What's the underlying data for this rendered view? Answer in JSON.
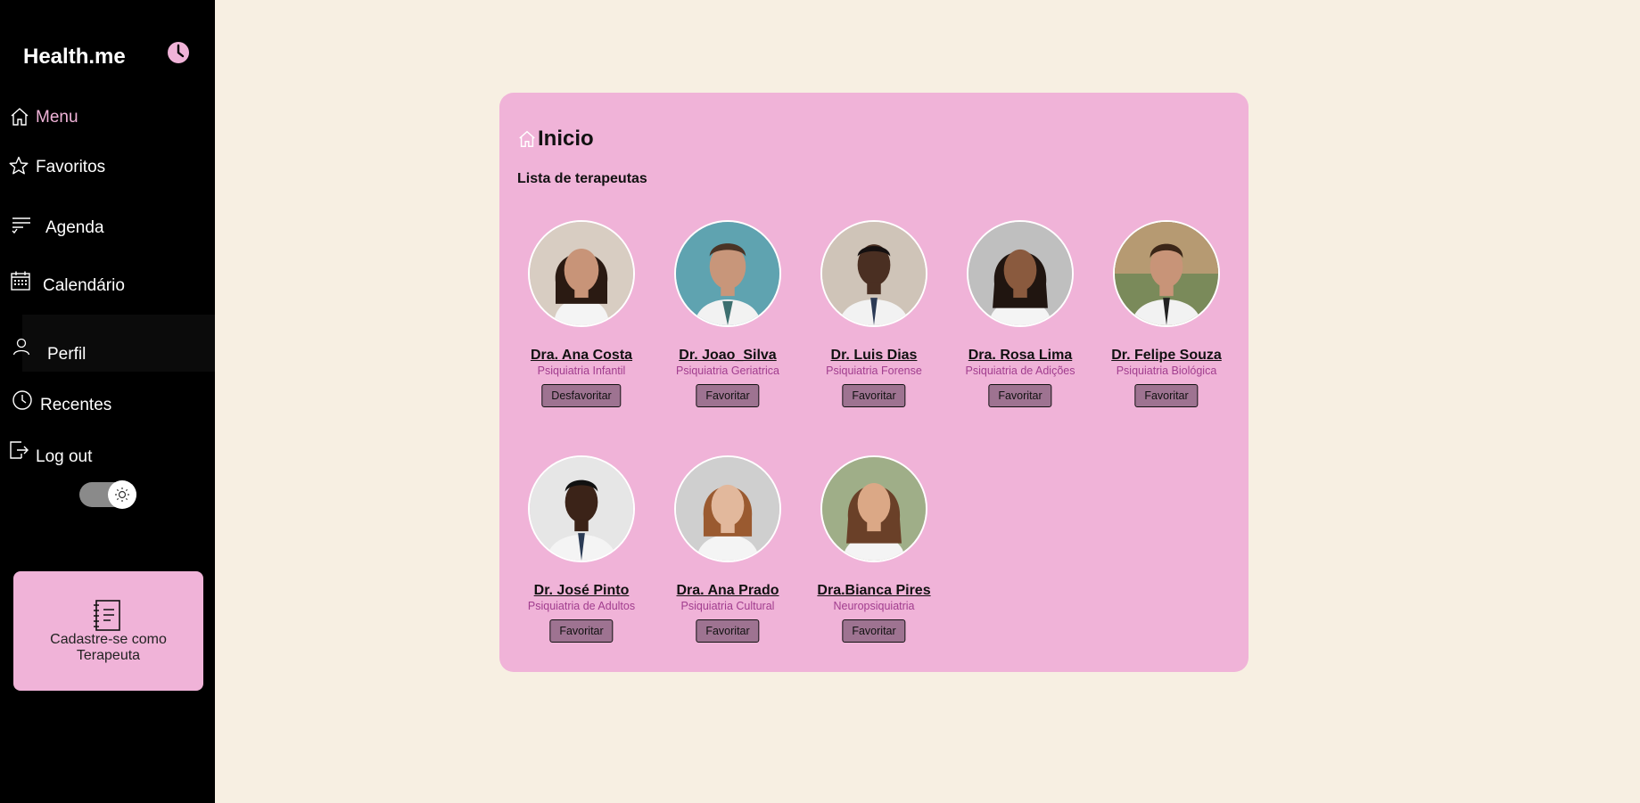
{
  "app": {
    "brand": "Health.me"
  },
  "sidebar": {
    "items": [
      {
        "label": "Menu",
        "icon": "home-icon"
      },
      {
        "label": "Favoritos",
        "icon": "star-icon"
      },
      {
        "label": "Agenda",
        "icon": "list-check-icon"
      },
      {
        "label": "Calendário",
        "icon": "calendar-icon"
      },
      {
        "label": "Perfil",
        "icon": "user-icon"
      },
      {
        "label": "Recentes",
        "icon": "clock-icon"
      },
      {
        "label": "Log out",
        "icon": "logout-icon"
      }
    ],
    "theme_toggle": {
      "icon": "sun-icon",
      "state": "on"
    },
    "cta": {
      "label": "Cadastre-se como Terapeuta",
      "icon": "notebook-icon"
    }
  },
  "main": {
    "title": "Inicio",
    "subtitle": "Lista de terapeutas",
    "therapists": [
      {
        "name": "Dra. Ana Costa",
        "specialty": "Psiquiatria Infantil",
        "button": "Desfavoritar"
      },
      {
        "name": "Dr. Joao_Silva",
        "specialty": "Psiquiatria Geriatrica",
        "button": "Favoritar"
      },
      {
        "name": "Dr. Luis Dias",
        "specialty": "Psiquiatria Forense",
        "button": "Favoritar"
      },
      {
        "name": "Dra. Rosa Lima",
        "specialty": "Psiquiatria de Adições",
        "button": "Favoritar"
      },
      {
        "name": "Dr. Felipe Souza",
        "specialty": "Psiquiatria Biológica",
        "button": "Favoritar"
      },
      {
        "name": "Dr. José Pinto",
        "specialty": "Psiquiatria de Adultos",
        "button": "Favoritar"
      },
      {
        "name": "Dra. Ana Prado",
        "specialty": "Psiquiatria Cultural",
        "button": "Favoritar"
      },
      {
        "name": "Dra.Bianca Pires",
        "specialty": "Neuropsiquiatria",
        "button": "Favoritar"
      }
    ]
  },
  "colors": {
    "sidebar_bg": "#000000",
    "page_bg": "#f7efe2",
    "panel_bg": "#f0b3d8",
    "accent_pink": "#f0b3d8",
    "specialty_text": "#a13d8e",
    "button_bg": "#9e7391"
  }
}
